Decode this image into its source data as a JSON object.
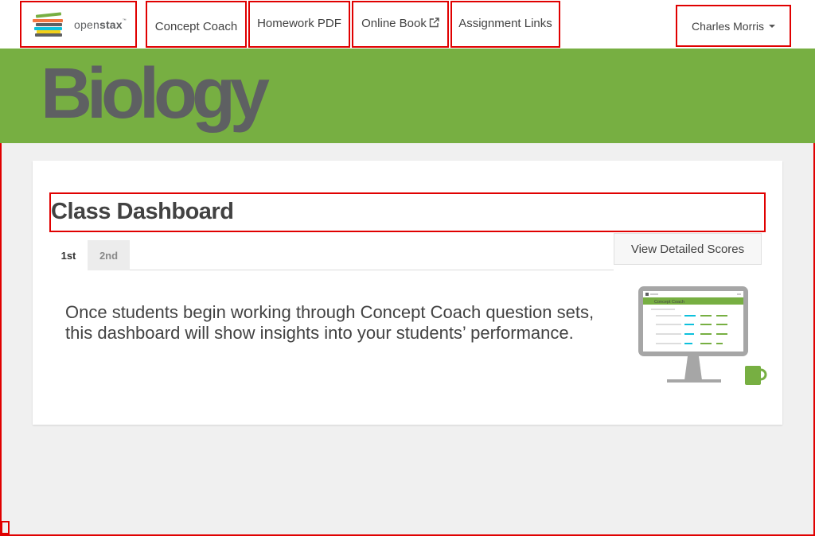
{
  "navbar": {
    "brand": {
      "name": "openstax",
      "name_light": "open",
      "name_bold": "stax",
      "tm": "™",
      "logo_colors": [
        "#77af42",
        "#f47641",
        "#5e6062",
        "#0dc0dc",
        "#f4d019",
        "#5e6062"
      ]
    },
    "links": [
      {
        "label": "Concept Coach"
      },
      {
        "label": "Homework PDF"
      },
      {
        "label": "Online Book",
        "icon": "external-link-icon"
      },
      {
        "label": "Assignment Links"
      }
    ],
    "user_menu": {
      "label": "Charles Morris",
      "icon": "caret-down-icon"
    }
  },
  "banner": {
    "title": "Biology",
    "color": "#77af42"
  },
  "dashboard": {
    "title": "Class Dashboard",
    "tabs": [
      {
        "label": "1st",
        "active": true
      },
      {
        "label": "2nd",
        "active": false
      }
    ],
    "view_scores_label": "View Detailed Scores",
    "empty_message": "Once students begin working through Concept Coach question sets, this dashboard will show insights into your students’ performance.",
    "illustration": {
      "screen_title": "Concept Coach",
      "icon": "monitor-and-mug-illustration"
    }
  },
  "colors": {
    "accent_green": "#77af42",
    "highlight_red": "#e00000",
    "text_dark": "#424242",
    "background": "#f0f0f0"
  }
}
